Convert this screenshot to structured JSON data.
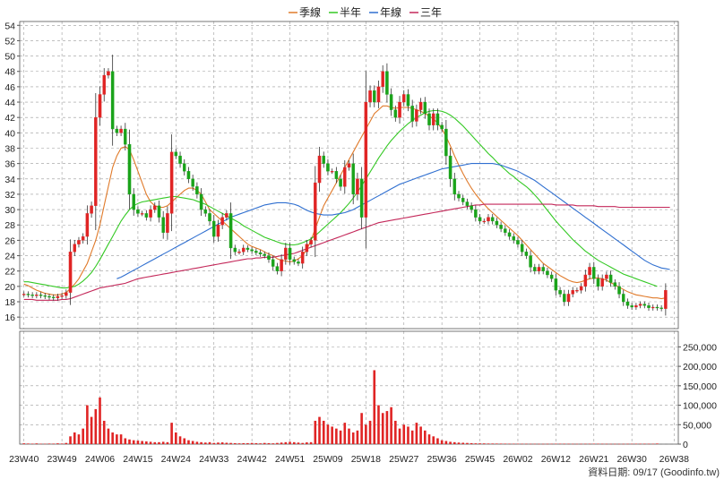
{
  "legend": [
    {
      "label": "季線",
      "color": "#e07a2a"
    },
    {
      "label": "半年",
      "color": "#34c924"
    },
    {
      "label": "年線",
      "color": "#2f6fd0"
    },
    {
      "label": "三年",
      "color": "#c4285a"
    }
  ],
  "footer": "資料日期: 09/17  (Goodinfo.tw)",
  "colors": {
    "up": "#e02424",
    "down": "#1aa31a",
    "volume": "#e02424",
    "grid": "#9a9a9a"
  },
  "chart_data": {
    "type": "candlestick",
    "x_ticks": [
      "23W40",
      "23W49",
      "24W06",
      "24W15",
      "24W24",
      "24W33",
      "24W42",
      "24W51",
      "25W09",
      "25W18",
      "25W27",
      "25W36",
      "25W45",
      "26W02",
      "26W12",
      "26W21",
      "26W30",
      "26W38"
    ],
    "y_ticks": [
      16,
      18,
      20,
      22,
      24,
      26,
      28,
      30,
      32,
      34,
      36,
      38,
      40,
      42,
      44,
      46,
      48,
      50,
      52,
      54
    ],
    "y_range": [
      14.5,
      54.5
    ],
    "volume_ticks": [
      0,
      50000,
      100000,
      150000,
      200000,
      250000
    ],
    "volume_tick_labels": [
      "0",
      "50,000",
      "100,000",
      "150,000",
      "200,000",
      "250,000"
    ],
    "volume_range": [
      0,
      290000
    ],
    "weeks": 155,
    "close": [
      19.0,
      18.9,
      18.8,
      18.9,
      18.8,
      18.7,
      18.6,
      18.5,
      18.7,
      18.8,
      19.2,
      24.5,
      25.5,
      26,
      26.5,
      29.5,
      30.5,
      42,
      45,
      47.5,
      48,
      40.5,
      40,
      40.5,
      38.5,
      32,
      30,
      29.5,
      29.5,
      29,
      30,
      30.5,
      29,
      27,
      29.5,
      37.5,
      37,
      36,
      35,
      34,
      33,
      32,
      30,
      29.5,
      28.5,
      26.5,
      28,
      29,
      29.5,
      25,
      24.5,
      24.5,
      25,
      24.8,
      24.6,
      24.4,
      24.2,
      24,
      23.5,
      22.6,
      22,
      23.5,
      25,
      23.5,
      23.2,
      23,
      24.5,
      25.5,
      26,
      33.5,
      37,
      36,
      35,
      35,
      34,
      33,
      35.5,
      36,
      32,
      34,
      29,
      44,
      45.5,
      44,
      46,
      48,
      45,
      43,
      42,
      44,
      45,
      43.5,
      41.5,
      43,
      44,
      42.5,
      41,
      42.5,
      41,
      40.5,
      37,
      34,
      32,
      31.5,
      31,
      30.5,
      30,
      29,
      28.5,
      28.5,
      29,
      28.5,
      28,
      27.5,
      27,
      26.5,
      26,
      25.5,
      24.5,
      24,
      22.5,
      22,
      22.5,
      22,
      21.5,
      21,
      19.5,
      19,
      18,
      19,
      19.5,
      19.5,
      20,
      21.5,
      22.5,
      21,
      20,
      21,
      21.5,
      20.5,
      20,
      19,
      18,
      17.5,
      17.3,
      17.5,
      17.7,
      17.5,
      17.2,
      17.3,
      17.2,
      17.1,
      19.5
    ],
    "ma_quarter": [
      20.3,
      20.1,
      19.8,
      19.5,
      19.3,
      19.1,
      19.0,
      18.9,
      18.9,
      19.0,
      19.2,
      19.7,
      20.3,
      21,
      22,
      23,
      24.5,
      26,
      28,
      30.5,
      33,
      35.5,
      37,
      38,
      38.2,
      37.8,
      36.5,
      35,
      33.5,
      32,
      31,
      30.5,
      30.3,
      30.3,
      30.5,
      31,
      31.5,
      32,
      32.5,
      32.8,
      32.8,
      32.5,
      32,
      31,
      30,
      29.5,
      29,
      28.5,
      28,
      27.5,
      27,
      26.5,
      26,
      25.5,
      25.2,
      25,
      24.8,
      24.5,
      24.2,
      24,
      23.6,
      23.4,
      23.3,
      23.2,
      23.3,
      23.6,
      24,
      24.8,
      26,
      27.5,
      29,
      30.5,
      31.5,
      32.5,
      33.5,
      34.5,
      35.5,
      36.5,
      37.5,
      38.5,
      39.5,
      40.5,
      41.5,
      42.5,
      43,
      43.5,
      43.5,
      43.3,
      43.2,
      43.3,
      43.3,
      43.3,
      43.2,
      43,
      42.8,
      42.5,
      42.2,
      41.8,
      41.3,
      40.5,
      39.5,
      38.3,
      37,
      35.8,
      34.7,
      33.7,
      32.8,
      32,
      31.3,
      30.7,
      30.1,
      29.6,
      29.1,
      28.6,
      28.1,
      27.6,
      27.1,
      26.6,
      26,
      25.4,
      24.8,
      24.2,
      23.6,
      23,
      22.6,
      22.2,
      21.8,
      21.4,
      21.1,
      20.8,
      20.6,
      20.5,
      20.6,
      20.8,
      21,
      21.1,
      21.1,
      21,
      20.8,
      20.5,
      20.2,
      19.9,
      19.6,
      19.3,
      19.1,
      18.9,
      18.8,
      18.7,
      18.6,
      18.5,
      18.5,
      18.4,
      18.5
    ],
    "ma_half": [
      20.6,
      20.6,
      20.5,
      20.4,
      20.3,
      20.2,
      20.1,
      20,
      19.9,
      19.8,
      19.8,
      19.9,
      20,
      20.3,
      20.7,
      21.2,
      21.8,
      22.6,
      23.5,
      24.5,
      25.5,
      26.5,
      27.5,
      28.5,
      29.3,
      30,
      30.5,
      30.8,
      31,
      31.1,
      31.2,
      31.3,
      31.4,
      31.5,
      31.6,
      31.7,
      31.7,
      31.6,
      31.5,
      31.4,
      31.3,
      31.1,
      30.9,
      30.7,
      30.4,
      30.1,
      29.8,
      29.5,
      29.2,
      28.9,
      28.6,
      28.3,
      27.9,
      27.6,
      27.3,
      27,
      26.7,
      26.4,
      26.2,
      26,
      25.8,
      25.6,
      25.5,
      25.4,
      25.4,
      25.5,
      25.7,
      25.9,
      26.2,
      26.6,
      27.1,
      27.6,
      28.1,
      28.6,
      29.1,
      29.6,
      30.2,
      30.8,
      31.5,
      32.3,
      33.1,
      34,
      34.9,
      35.8,
      36.7,
      37.5,
      38.3,
      39,
      39.6,
      40.2,
      40.7,
      41.2,
      41.6,
      42,
      42.3,
      42.6,
      42.8,
      42.9,
      42.9,
      42.8,
      42.6,
      42.3,
      41.9,
      41.4,
      40.9,
      40.3,
      39.7,
      39.1,
      38.5,
      37.9,
      37.3,
      36.8,
      36.2,
      35.7,
      35.2,
      34.7,
      34.3,
      33.8,
      33.4,
      33,
      32.5,
      31.9,
      31.3,
      30.6,
      29.9,
      29.2,
      28.5,
      27.9,
      27.3,
      26.7,
      26.1,
      25.6,
      25.1,
      24.6,
      24.2,
      23.8,
      23.4,
      23.1,
      22.8,
      22.5,
      22.2,
      21.9,
      21.6,
      21.4,
      21.2,
      21,
      20.8,
      20.6,
      20.4,
      20.2,
      20
    ],
    "ma_year": [
      null,
      null,
      null,
      null,
      null,
      null,
      null,
      null,
      null,
      null,
      null,
      null,
      null,
      null,
      null,
      null,
      null,
      null,
      null,
      null,
      null,
      null,
      21,
      21.2,
      21.5,
      21.8,
      22.1,
      22.4,
      22.7,
      23,
      23.3,
      23.6,
      23.9,
      24.2,
      24.5,
      24.8,
      25.1,
      25.4,
      25.7,
      26,
      26.3,
      26.6,
      26.9,
      27.2,
      27.5,
      27.8,
      28.1,
      28.4,
      28.7,
      29,
      29.2,
      29.4,
      29.6,
      29.8,
      30,
      30.2,
      30.4,
      30.6,
      30.7,
      30.8,
      30.9,
      30.9,
      30.9,
      30.8,
      30.7,
      30.5,
      30.2,
      29.9,
      29.7,
      29.5,
      29.4,
      29.3,
      29.3,
      29.3,
      29.4,
      29.5,
      29.6,
      29.8,
      30,
      30.3,
      30.6,
      30.9,
      31.2,
      31.5,
      31.8,
      32.1,
      32.4,
      32.7,
      33,
      33.3,
      33.5,
      33.7,
      33.9,
      34.1,
      34.3,
      34.5,
      34.7,
      34.9,
      35.1,
      35.3,
      35.4,
      35.5,
      35.6,
      35.7,
      35.8,
      35.9,
      36,
      36,
      36,
      36,
      36,
      36,
      35.9,
      35.8,
      35.6,
      35.4,
      35.2,
      35,
      34.7,
      34.4,
      34.1,
      33.8,
      33.4,
      33,
      32.6,
      32.2,
      31.8,
      31.4,
      31,
      30.6,
      30.2,
      29.8,
      29.4,
      29,
      28.6,
      28.2,
      27.8,
      27.4,
      27,
      26.6,
      26.2,
      25.8,
      25.4,
      25,
      24.6,
      24.2,
      23.8,
      23.4,
      23.1,
      22.8,
      22.6,
      22.4,
      22.3,
      22.2
    ],
    "ma_3year": [
      18.3,
      18.3,
      18.3,
      18.2,
      18.2,
      18.2,
      18.2,
      18.2,
      18.2,
      18.3,
      18.3,
      18.4,
      18.6,
      18.8,
      19.0,
      19.2,
      19.4,
      19.6,
      19.8,
      19.9,
      20,
      20.1,
      20.2,
      20.3,
      20.4,
      20.6,
      20.8,
      21,
      21.1,
      21.2,
      21.3,
      21.4,
      21.5,
      21.6,
      21.7,
      21.8,
      21.9,
      22,
      22.1,
      22.2,
      22.3,
      22.4,
      22.5,
      22.6,
      22.7,
      22.8,
      22.9,
      23,
      23.1,
      23.2,
      23.3,
      23.4,
      23.5,
      23.6,
      23.6,
      23.7,
      23.7,
      23.8,
      23.8,
      23.8,
      23.9,
      24,
      24.1,
      24.2,
      24.3,
      24.5,
      24.7,
      24.9,
      25.1,
      25.3,
      25.5,
      25.7,
      25.9,
      26.1,
      26.3,
      26.5,
      26.7,
      26.9,
      27.1,
      27.3,
      27.5,
      27.7,
      27.9,
      28.1,
      28.3,
      28.4,
      28.5,
      28.6,
      28.7,
      28.8,
      28.9,
      29,
      29.1,
      29.2,
      29.3,
      29.4,
      29.5,
      29.6,
      29.7,
      29.8,
      29.9,
      30,
      30.1,
      30.2,
      30.3,
      30.4,
      30.5,
      30.6,
      30.6,
      30.7,
      30.7,
      30.7,
      30.7,
      30.7,
      30.7,
      30.7,
      30.7,
      30.7,
      30.7,
      30.7,
      30.7,
      30.7,
      30.7,
      30.7,
      30.7,
      30.7,
      30.6,
      30.6,
      30.6,
      30.6,
      30.6,
      30.5,
      30.5,
      30.5,
      30.5,
      30.5,
      30.4,
      30.4,
      30.4,
      30.4,
      30.4,
      30.3,
      30.3,
      30.3,
      30.3,
      30.3,
      30.3,
      30.3,
      30.3,
      30.3,
      30.3,
      30.3,
      30.3,
      30.3
    ],
    "volume": [
      2000,
      1500,
      1200,
      1800,
      1000,
      900,
      1400,
      1300,
      2000,
      1500,
      3000,
      20000,
      30000,
      25000,
      40000,
      100000,
      70000,
      90000,
      120000,
      60000,
      40000,
      30000,
      25000,
      25000,
      15000,
      12000,
      10000,
      9000,
      8000,
      7000,
      6000,
      5000,
      5000,
      6000,
      5000,
      55000,
      30000,
      20000,
      15000,
      10000,
      8000,
      6000,
      5000,
      4000,
      5000,
      3000,
      4000,
      4500,
      3500,
      3000,
      2500,
      2000,
      2500,
      2500,
      3000,
      2500,
      2000,
      3000,
      2500,
      2000,
      3000,
      4000,
      5000,
      6000,
      5000,
      4000,
      3000,
      4500,
      5000,
      60000,
      70000,
      60000,
      50000,
      45000,
      40000,
      35000,
      55000,
      40000,
      30000,
      35000,
      80000,
      50000,
      60000,
      190000,
      100000,
      80000,
      85000,
      95000,
      60000,
      40000,
      50000,
      45000,
      35000,
      55000,
      45000,
      35000,
      25000,
      20000,
      15000,
      10000,
      8000,
      6000,
      5000,
      4000,
      3500,
      3000,
      2500,
      2000,
      2000,
      1800,
      1500,
      1500,
      1400,
      1300,
      1200,
      1100,
      1000,
      1000,
      900,
      900,
      800,
      800,
      700,
      700,
      800,
      900,
      1000,
      1100,
      1000,
      900,
      800,
      700,
      800,
      900,
      1000,
      1100,
      1000,
      900,
      800,
      700,
      700,
      700,
      700,
      800,
      900,
      1000,
      1000,
      1000,
      900,
      900,
      1500
    ]
  }
}
